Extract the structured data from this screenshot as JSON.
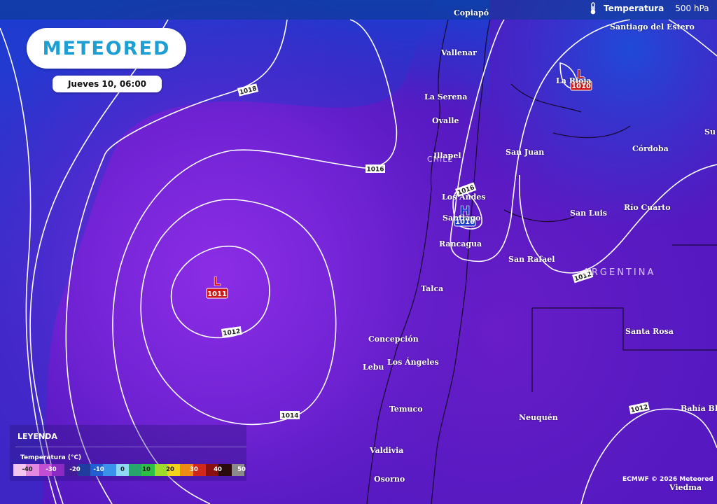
{
  "brand": {
    "logo": "METEORED"
  },
  "datetime": "Jueves 10, 06:00",
  "layer": {
    "icon": "thermometer-icon",
    "name": "Temperatura",
    "level": "500 hPa"
  },
  "cities": [
    {
      "name": "Copiapó",
      "key": "copiapo"
    },
    {
      "name": "Santiago del Estero",
      "key": "santiago-del-estero"
    },
    {
      "name": "Vallenar",
      "key": "vallenar"
    },
    {
      "name": "La Rioja",
      "key": "la-rioja"
    },
    {
      "name": "La Serena",
      "key": "la-serena"
    },
    {
      "name": "Ovalle",
      "key": "ovalle"
    },
    {
      "name": "Córdoba",
      "key": "cordoba"
    },
    {
      "name": "Illapel",
      "key": "illapel"
    },
    {
      "name": "San Juan",
      "key": "san-juan"
    },
    {
      "name": "Los Andes",
      "key": "los-andes"
    },
    {
      "name": "Santiago",
      "key": "santiago"
    },
    {
      "name": "San Luis",
      "key": "san-luis"
    },
    {
      "name": "Río Cuarto",
      "key": "rio-cuarto"
    },
    {
      "name": "Rancagua",
      "key": "rancagua"
    },
    {
      "name": "San Rafael",
      "key": "san-rafael"
    },
    {
      "name": "Talca",
      "key": "talca"
    },
    {
      "name": "Santa Rosa",
      "key": "santa-rosa"
    },
    {
      "name": "Concepción",
      "key": "concepcion"
    },
    {
      "name": "Lebu",
      "key": "lebu"
    },
    {
      "name": "Los Ángeles",
      "key": "los-angeles"
    },
    {
      "name": "Temuco",
      "key": "temuco"
    },
    {
      "name": "Neuquén",
      "key": "neuquen"
    },
    {
      "name": "Bahía Blan",
      "key": "bahia-blanca"
    },
    {
      "name": "Valdivia",
      "key": "valdivia"
    },
    {
      "name": "Osorno",
      "key": "osorno"
    },
    {
      "name": "Viedma",
      "key": "viedma"
    },
    {
      "name": "Su",
      "key": "su"
    }
  ],
  "countries": {
    "chile": "CHILE",
    "argentina": "ARGENTINA"
  },
  "isobars": [
    "1018",
    "1016",
    "1012",
    "1014",
    "1016",
    "1012",
    "1012"
  ],
  "pressure_centers": [
    {
      "type": "L",
      "value": "1011",
      "key": "low-pacific",
      "color": "#d01818"
    },
    {
      "type": "L",
      "value": "1010",
      "key": "low-la-rioja",
      "color": "#d01818"
    },
    {
      "type": "H",
      "value": "1016",
      "key": "high-santiago",
      "color": "#1838c8"
    }
  ],
  "legend": {
    "title": "LEYENDA",
    "subtitle": "Temperatura (°C)",
    "colors": [
      "#f4c6ef",
      "#e38ae0",
      "#c24fd2",
      "#8d2ac4",
      "#431c9a",
      "#1f3c9e",
      "#1f5fd2",
      "#3a93ea",
      "#8fd8f4",
      "#27a56c",
      "#2cbf45",
      "#9edb2a",
      "#f3d21c",
      "#ef8a14",
      "#d2281c",
      "#8a1010",
      "#2a0a0a",
      "#8a8a8a"
    ],
    "labels": [
      "-40",
      "-30",
      "-20",
      "-10",
      "0",
      "10",
      "20",
      "30",
      "40",
      "50"
    ]
  },
  "credit": "ECMWF © 2026 Meteored"
}
